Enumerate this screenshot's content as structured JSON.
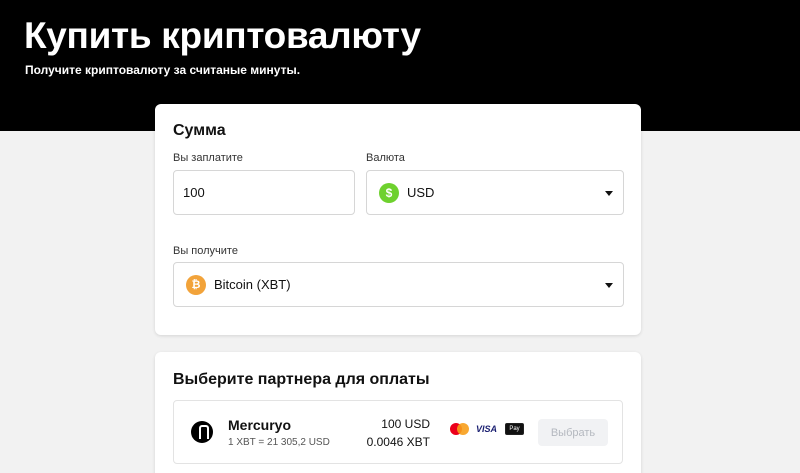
{
  "hero": {
    "title": "Купить криптовалюту",
    "subtitle": "Получите криптовалюту за считаные минуты."
  },
  "amount_card": {
    "title": "Сумма",
    "pay_label": "Вы заплатите",
    "pay_value": "100",
    "currency_label": "Валюта",
    "currency_value": "USD",
    "currency_icon": "dollar-coin-icon",
    "receive_label": "Вы получите",
    "receive_value": "Bitcoin (XBT)",
    "receive_icon": "bitcoin-coin-icon"
  },
  "partner_card": {
    "title": "Выберите партнера для оплаты",
    "providers": [
      {
        "name": "Mercuryo",
        "rate": "1 XBT = 21 305,2 USD",
        "fiat_amount": "100 USD",
        "crypto_amount": "0.0046 XBT",
        "payment_methods": [
          "mastercard-icon",
          "visa-icon",
          "apple-pay-icon"
        ],
        "visa_text": "VISA",
        "apple_pay_text": " Pay",
        "select_label": "Выбрать"
      }
    ]
  },
  "colors": {
    "hero_bg": "#000000",
    "usd_green": "#6ed12e",
    "btc_orange": "#f2a33a",
    "disabled_button_bg": "#f1f2f4"
  }
}
